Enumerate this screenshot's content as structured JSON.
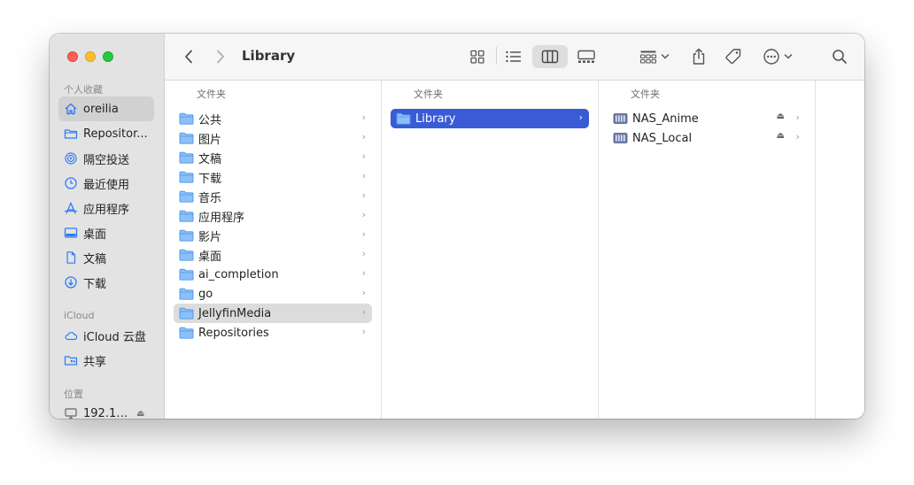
{
  "window": {
    "title": "Library"
  },
  "sidebar": {
    "sections": [
      {
        "title": "个人收藏"
      },
      {
        "title": "iCloud"
      },
      {
        "title": "位置"
      }
    ],
    "favorites": [
      {
        "label": "oreilia",
        "icon": "house-icon",
        "selected": true
      },
      {
        "label": "Repositor...",
        "icon": "folder-icon"
      },
      {
        "label": "隔空投送",
        "icon": "airdrop-icon"
      },
      {
        "label": "最近使用",
        "icon": "clock-icon"
      },
      {
        "label": "应用程序",
        "icon": "apps-icon"
      },
      {
        "label": "桌面",
        "icon": "desktop-icon"
      },
      {
        "label": "文稿",
        "icon": "document-icon"
      },
      {
        "label": "下载",
        "icon": "download-icon"
      }
    ],
    "icloud": [
      {
        "label": "iCloud 云盘",
        "icon": "cloud-icon"
      },
      {
        "label": "共享",
        "icon": "shared-folder-icon"
      }
    ],
    "locations": [
      {
        "label": "192.16...",
        "icon": "computer-icon",
        "eject": "⏏"
      }
    ]
  },
  "toolbar": {
    "back": "‹",
    "forward": "›",
    "title": "Library"
  },
  "columns": [
    {
      "header": "文件夹",
      "items": [
        {
          "label": "公共",
          "chevron": "›"
        },
        {
          "label": "图片",
          "chevron": "›"
        },
        {
          "label": "文稿",
          "chevron": "›"
        },
        {
          "label": "下载",
          "chevron": "›"
        },
        {
          "label": "音乐",
          "chevron": "›"
        },
        {
          "label": "应用程序",
          "chevron": "›"
        },
        {
          "label": "影片",
          "chevron": "›"
        },
        {
          "label": "桌面",
          "chevron": "›"
        },
        {
          "label": "ai_completion",
          "chevron": "›"
        },
        {
          "label": "go",
          "chevron": "›"
        },
        {
          "label": "JellyfinMedia",
          "chevron": "›",
          "selected": "inactive"
        },
        {
          "label": "Repositories",
          "chevron": "›"
        }
      ]
    },
    {
      "header": "文件夹",
      "items": [
        {
          "label": "Library",
          "chevron": "›",
          "selected": "active"
        }
      ]
    },
    {
      "header": "文件夹",
      "items": [
        {
          "label": "NAS_Anime",
          "chevron": "›",
          "eject": "⏏",
          "icon": "network-volume-icon"
        },
        {
          "label": "NAS_Local",
          "chevron": "›",
          "eject": "⏏",
          "icon": "network-volume-icon"
        }
      ]
    }
  ],
  "colors": {
    "accent": "#3a5bd6",
    "folder": "#69aef5",
    "sidebar_icon": "#2f7cf6"
  }
}
